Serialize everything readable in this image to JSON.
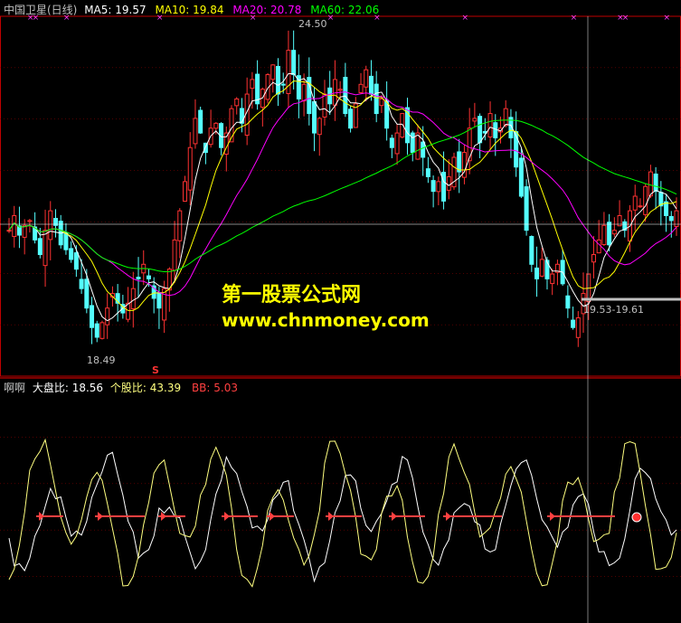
{
  "main_header": {
    "title": "中国卫星(日线)",
    "ma5": "MA5: 19.57",
    "ma10": "MA10: 19.84",
    "ma20": "MA20: 20.78",
    "ma60": "MA60: 22.06"
  },
  "sub_header": {
    "title": "啊啊",
    "dapanbi": "大盘比: 18.56",
    "gegubi": "个股比: 43.39",
    "bb": "BB: 5.03"
  },
  "watermark": {
    "line1": "第一股票公式网",
    "line2": "www.chnmoney.com"
  },
  "annotations": {
    "high": "24.50",
    "low": "18.49",
    "cursor": "19.53-19.61",
    "signal": "S"
  },
  "colors": {
    "up": "#ff3232",
    "down": "#54ffff",
    "ma5": "#ffffff",
    "ma10": "#ffff00",
    "ma20": "#ff00ff",
    "ma60": "#00ff00",
    "grid": "#800000",
    "border": "#c00000",
    "dapanbi": "#ffffff",
    "gegubi": "#ffff80",
    "bb": "#ff4040"
  },
  "chart_data": [
    {
      "type": "candlestick",
      "title": "中国卫星(日线)",
      "ylim": [
        17.8,
        25.2
      ],
      "series": [
        {
          "name": "MA5",
          "last": 19.57
        },
        {
          "name": "MA10",
          "last": 19.84
        },
        {
          "name": "MA20",
          "last": 20.78
        },
        {
          "name": "MA60",
          "last": 22.06
        }
      ],
      "close": [
        20.8,
        21.1,
        20.7,
        20.9,
        21.0,
        20.6,
        20.3,
        20.8,
        21.2,
        20.9,
        20.5,
        20.4,
        20.2,
        20.0,
        19.6,
        19.2,
        18.8,
        18.6,
        18.9,
        19.2,
        19.5,
        19.3,
        19.1,
        19.3,
        19.6,
        19.8,
        20.1,
        19.8,
        19.4,
        19.2,
        19.6,
        20.0,
        20.6,
        21.2,
        21.8,
        22.5,
        23.1,
        22.8,
        22.4,
        22.9,
        23.0,
        22.5,
        22.8,
        23.3,
        23.5,
        23.0,
        23.6,
        23.9,
        23.4,
        23.7,
        24.0,
        24.2,
        23.6,
        23.8,
        24.5,
        24.0,
        23.5,
        23.8,
        23.2,
        22.8,
        23.1,
        23.6,
        23.4,
        23.9,
        23.7,
        23.2,
        22.9,
        23.4,
        23.8,
        24.1,
        23.6,
        23.2,
        23.5,
        22.9,
        22.5,
        22.8,
        23.2,
        22.6,
        22.4,
        22.8,
        22.3,
        21.9,
        21.6,
        21.8,
        21.4,
        21.9,
        22.3,
        22.0,
        22.4,
        22.9,
        23.1,
        22.6,
        22.8,
        23.2,
        22.7,
        22.9,
        23.3,
        22.7,
        22.1,
        21.5,
        20.8,
        20.1,
        19.8,
        20.2,
        19.8,
        19.9,
        20.1,
        19.7,
        19.2,
        18.8,
        19.0,
        19.5,
        19.9,
        20.3,
        20.6,
        20.9,
        20.5,
        20.8,
        21.1,
        20.8,
        21.2,
        21.5,
        21.3,
        21.7,
        22.0,
        21.6,
        21.3,
        21.1,
        21.0,
        21.2
      ],
      "signal_days": [
        [
          3,
          4
        ],
        [
          9
        ],
        [
          23
        ],
        [
          38
        ],
        [
          50
        ],
        [
          57
        ],
        [
          71
        ],
        [
          88
        ],
        [
          95
        ],
        [
          96
        ],
        [
          102
        ]
      ]
    },
    {
      "type": "line",
      "series": [
        {
          "name": "大盘比",
          "last": 18.56
        },
        {
          "name": "个股比",
          "last": 43.39
        },
        {
          "name": "BB",
          "last": 5.03
        }
      ]
    }
  ]
}
